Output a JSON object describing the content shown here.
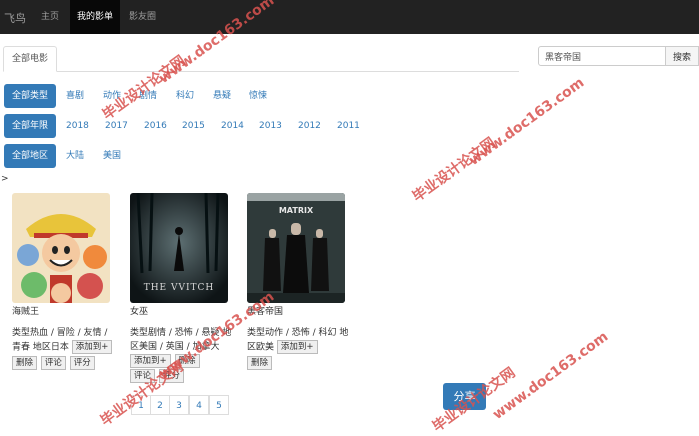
{
  "nav": {
    "brand": "飞鸟",
    "items": [
      "主页",
      "我的影单",
      "影友圈"
    ],
    "active_index": 1
  },
  "tabs": {
    "active": "全部电影"
  },
  "search": {
    "value": "黑客帝国",
    "button": "搜索"
  },
  "filters": {
    "types": {
      "active": "全部类型",
      "options": [
        "喜剧",
        "动作",
        "剧情",
        "科幻",
        "悬疑",
        "惊悚"
      ]
    },
    "years": {
      "active": "全部年限",
      "options": [
        "2018",
        "2017",
        "2016",
        "2015",
        "2014",
        "2013",
        "2012",
        "2011"
      ]
    },
    "regions": {
      "active": "全部地区",
      "options": [
        "大陆",
        "美国"
      ]
    }
  },
  "caret": ">",
  "movies": [
    {
      "title": "海贼王",
      "meta": "类型热血 / 冒险 / 友情 / 青春 地区日本",
      "buttons": [
        "添加到+",
        "删除",
        "评论",
        "评分"
      ],
      "poster_caption": ""
    },
    {
      "title": "女巫",
      "meta": "类型剧情 / 恐怖 / 悬疑 地区美国 / 英国 / 加拿大",
      "buttons": [
        "添加到+",
        "删除",
        "评论",
        "评分"
      ],
      "poster_caption": "THE VVITCH"
    },
    {
      "title": "黑客帝国",
      "meta": "类型动作 / 恐怖 / 科幻 地区欧美",
      "buttons": [
        "添加到+",
        "删除"
      ],
      "poster_caption": "MATRIX"
    }
  ],
  "pagination": [
    "1",
    "2",
    "3",
    "4",
    "5"
  ],
  "share": {
    "label": "分享"
  },
  "watermarks": [
    "毕业设计论文网",
    "www.doc163.com"
  ],
  "colors": {
    "navbar": "#222222",
    "primary": "#337ab7",
    "watermark": "#d9534f"
  }
}
